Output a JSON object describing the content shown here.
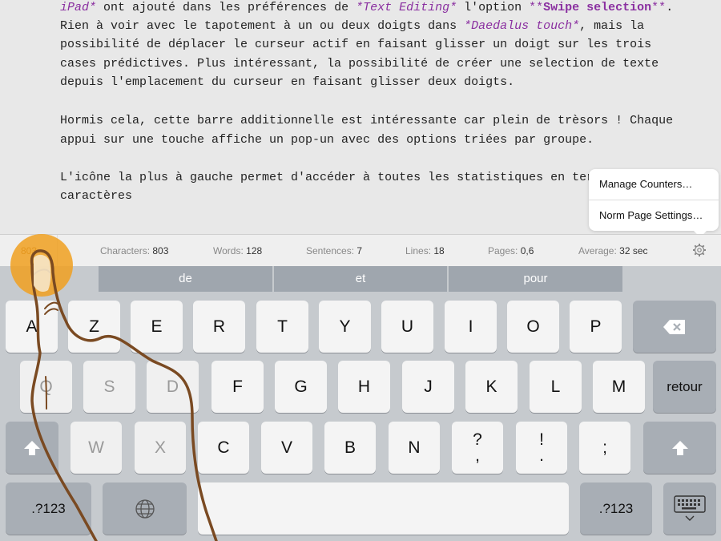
{
  "editor": {
    "lines": [
      [
        {
          "t": "iPad*",
          "c": "it"
        },
        {
          "t": " ont ajouté dans les préférences de "
        },
        {
          "t": "*Text Editing*",
          "c": "it"
        },
        {
          "t": " l'option "
        },
        {
          "t": "**",
          "c": "md"
        },
        {
          "t": "Swipe selection",
          "c": "bd"
        },
        {
          "t": "**",
          "c": "md"
        },
        {
          "t": "."
        }
      ],
      [
        {
          "t": "Rien à voir avec le tapotement à un ou deux doigts dans "
        },
        {
          "t": "*Daedalus touch*",
          "c": "it"
        },
        {
          "t": ", mais la"
        }
      ],
      [
        {
          "t": "possibilité de déplacer le curseur actif en faisant glisser un doigt sur les trois"
        }
      ],
      [
        {
          "t": "cases prédictives. Plus intéressant, la possibilité de créer une selection de texte"
        }
      ],
      [
        {
          "t": "depuis l'emplacement du curseur en faisant glisser deux doigts."
        }
      ],
      [
        {
          "t": ""
        }
      ],
      [
        {
          "t": "Hormis cela, cette barre additionnelle est intéressante car plein de trèsors ! Chaque"
        }
      ],
      [
        {
          "t": "appui sur une touche affiche un pop-un avec des options triées par groupe."
        }
      ],
      [
        {
          "t": ""
        }
      ],
      [
        {
          "t": "L'icône la plus à gauche permet d'accéder à toutes les statistiques en terme"
        }
      ],
      [
        {
          "t": "caractères"
        }
      ]
    ]
  },
  "popover": {
    "items": [
      "Manage Counters…",
      "Norm Page Settings…"
    ]
  },
  "stats": {
    "count_cell": "803",
    "characters": {
      "label": "Characters:",
      "value": "803"
    },
    "words": {
      "label": "Words:",
      "value": "128"
    },
    "sentences": {
      "label": "Sentences:",
      "value": "7"
    },
    "lines": {
      "label": "Lines:",
      "value": "18"
    },
    "pages": {
      "label": "Pages:",
      "value": "0,6"
    },
    "average": {
      "label": "Average:",
      "value": "32 sec"
    },
    "settings_icon": "gear-icon"
  },
  "suggestions": [
    "de",
    "et",
    "pour"
  ],
  "keyboard": {
    "row1": [
      "A",
      "Z",
      "E",
      "R",
      "T",
      "Y",
      "U",
      "I",
      "O",
      "P"
    ],
    "row2": [
      "Q",
      "S",
      "D",
      "F",
      "G",
      "H",
      "J",
      "K",
      "L",
      "M"
    ],
    "return_label": "retour",
    "row3": [
      "W",
      "X",
      "C",
      "V",
      "B",
      "N"
    ],
    "row3_punct": [
      {
        "top": "?",
        "bottom": ","
      },
      {
        "top": "!",
        "bottom": "."
      },
      {
        "top": ";",
        "bottom": ""
      }
    ],
    "numbers_label": ".?123",
    "icons": {
      "backspace": "backspace-icon",
      "shift": "shift-icon",
      "globe": "globe-icon",
      "hide_keyboard": "keyboard-hide-icon"
    }
  },
  "colors": {
    "markdown": "#8a2fa0",
    "touch_indicator": "#f0a020",
    "finger_outline": "#7a4a22"
  }
}
